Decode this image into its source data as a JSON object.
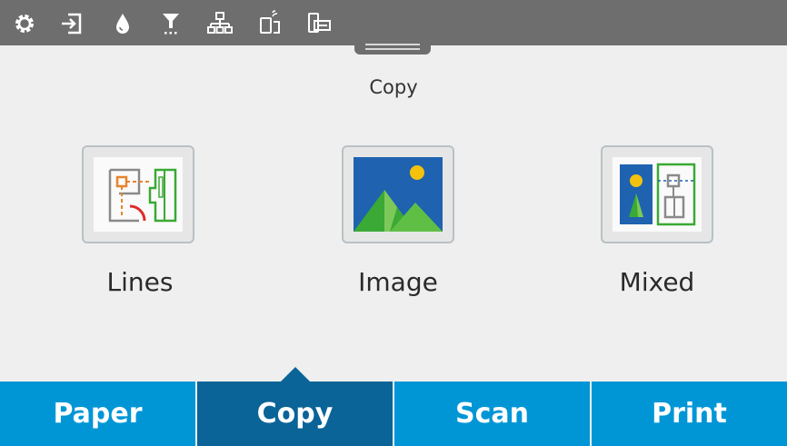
{
  "status_bar": {
    "icons": [
      "settings-icon",
      "sign-in-icon",
      "ink-drop-icon",
      "printhead-icon",
      "network-icon",
      "wireless-direct-icon",
      "device-connect-icon"
    ]
  },
  "page": {
    "title": "Copy"
  },
  "copy_modes": [
    {
      "label": "Lines",
      "icon": "lines-drawing-icon"
    },
    {
      "label": "Image",
      "icon": "landscape-image-icon"
    },
    {
      "label": "Mixed",
      "icon": "mixed-content-icon"
    }
  ],
  "tabs": [
    {
      "label": "Paper",
      "active": false
    },
    {
      "label": "Copy",
      "active": true
    },
    {
      "label": "Scan",
      "active": false
    },
    {
      "label": "Print",
      "active": false
    }
  ],
  "colors": {
    "status_bar": "#6e6e6e",
    "tab_bar": "#0096d6",
    "tab_active": "#0a6497",
    "background": "#efefef"
  }
}
